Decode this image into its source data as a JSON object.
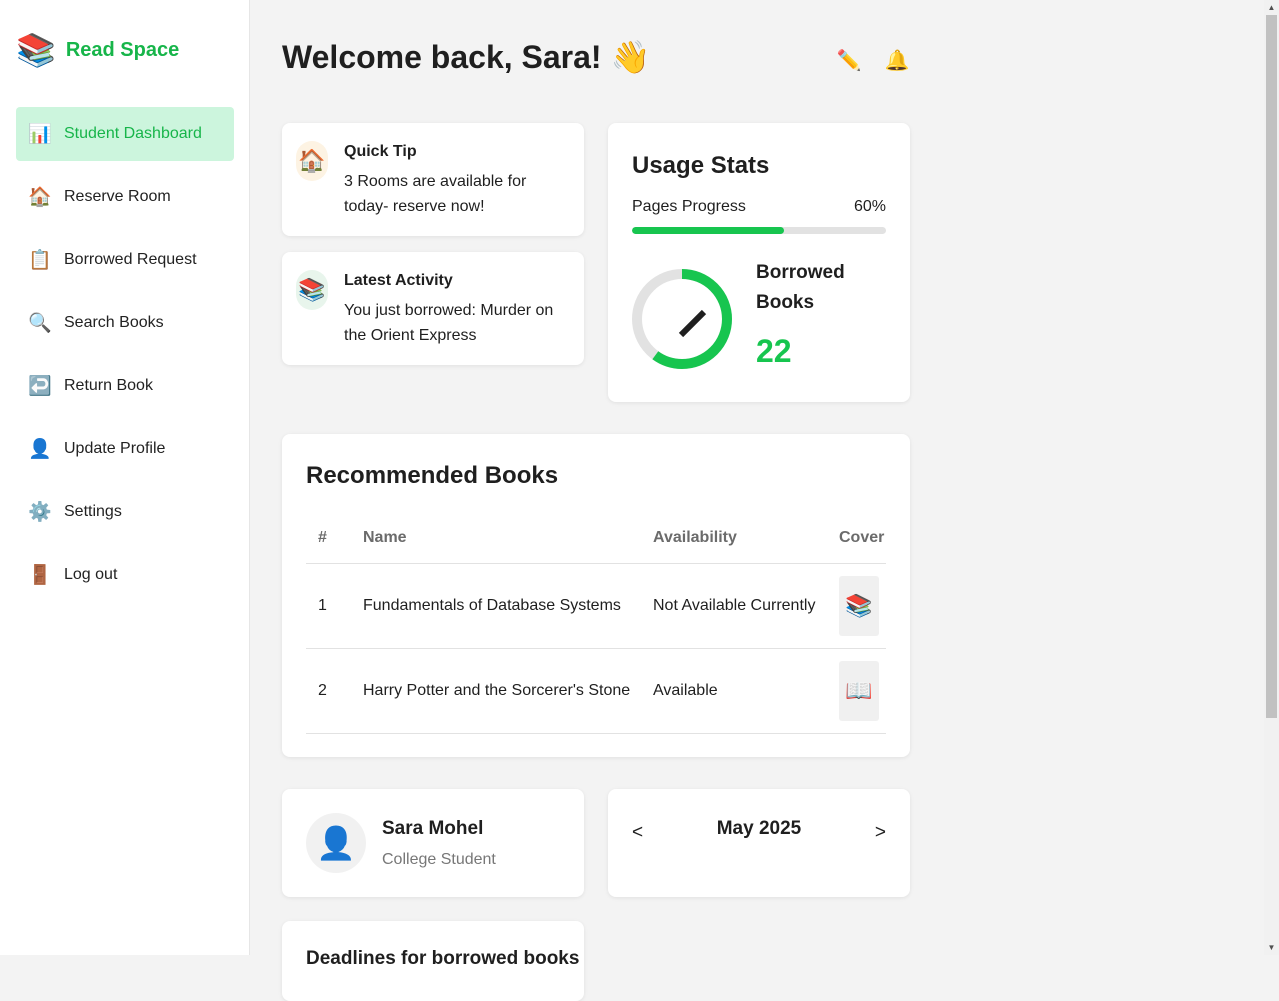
{
  "brand": {
    "logo_icon": "books-icon",
    "name": "Read Space",
    "color": "#17b54a"
  },
  "sidebar": {
    "items": [
      {
        "icon": "📊",
        "icon_name": "chart-icon",
        "label": "Student Dashboard",
        "active": true
      },
      {
        "icon": "🏠",
        "icon_name": "house-icon",
        "label": "Reserve Room"
      },
      {
        "icon": "📋",
        "icon_name": "clipboard-icon",
        "label": "Borrowed Request"
      },
      {
        "icon": "🔍",
        "icon_name": "search-icon",
        "label": "Search Books"
      },
      {
        "icon": "↩️",
        "icon_name": "return-icon",
        "label": "Return Book"
      },
      {
        "icon": "👤",
        "icon_name": "user-icon",
        "label": "Update Profile"
      },
      {
        "icon": "⚙️",
        "icon_name": "gear-icon",
        "label": "Settings"
      },
      {
        "icon": "🚪",
        "icon_name": "door-icon",
        "label": "Log out"
      }
    ]
  },
  "header": {
    "welcome": "Welcome back, Sara! 👋"
  },
  "quick_tip": {
    "title": "Quick Tip",
    "body": "3 Rooms are available for today- reserve now!"
  },
  "latest_activity": {
    "title": "Latest Activity",
    "body": "You just borrowed: Murder on the Orient Express"
  },
  "usage_stats": {
    "title": "Usage Stats",
    "progress_label": "Pages Progress",
    "progress_text": "60%",
    "progress_value": 0.6,
    "borrowed_label": "Borrowed Books",
    "borrowed_count": "22",
    "accent": "#17c54f"
  },
  "recommended": {
    "title": "Recommended Books",
    "columns": [
      "#",
      "Name",
      "Availability",
      "Cover"
    ],
    "rows": [
      {
        "num": "1",
        "name": "Fundamentals of Database Systems",
        "availability": "Not Available Currently",
        "cover": "📚"
      },
      {
        "num": "2",
        "name": "Harry Potter and the Sorcerer's Stone",
        "availability": "Available",
        "cover": "📖"
      }
    ]
  },
  "profile": {
    "name": "Sara Mohel",
    "role": "College Student"
  },
  "calendar": {
    "month": "May 2025",
    "prev": "<",
    "next": ">"
  },
  "bottom_card": {
    "title": "Deadlines for borrowed books"
  }
}
